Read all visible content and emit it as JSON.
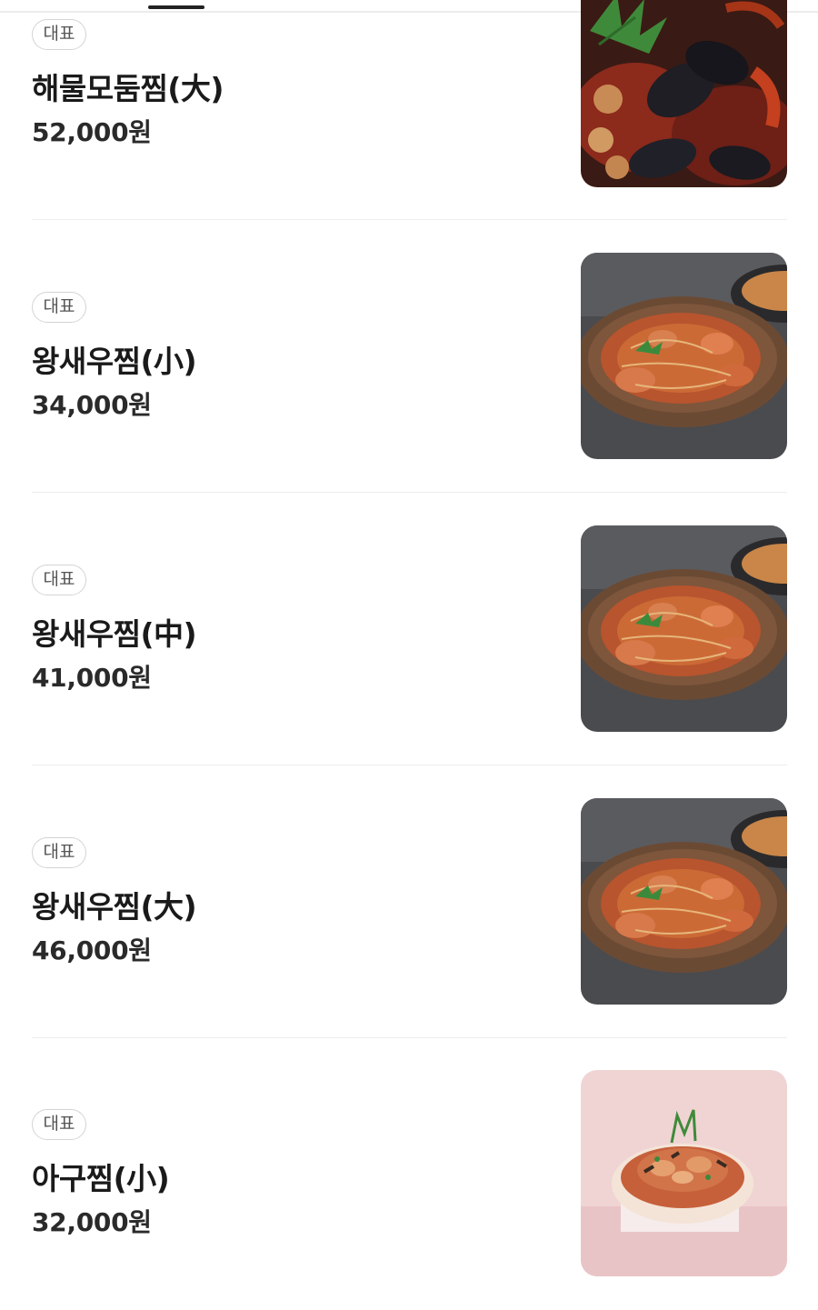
{
  "menu": {
    "items": [
      {
        "badge": "대표",
        "name": "해물모둠찜(大)",
        "price": "52,000원",
        "image": "seafood-assorted-steamed-photo"
      },
      {
        "badge": "대표",
        "name": "왕새우찜(小)",
        "price": "34,000원",
        "image": "king-prawn-steamed-photo"
      },
      {
        "badge": "대표",
        "name": "왕새우찜(中)",
        "price": "41,000원",
        "image": "king-prawn-steamed-photo"
      },
      {
        "badge": "대표",
        "name": "왕새우찜(大)",
        "price": "46,000원",
        "image": "king-prawn-steamed-photo"
      },
      {
        "badge": "대표",
        "name": "아구찜(小)",
        "price": "32,000원",
        "image": "monkfish-steamed-photo"
      }
    ]
  }
}
